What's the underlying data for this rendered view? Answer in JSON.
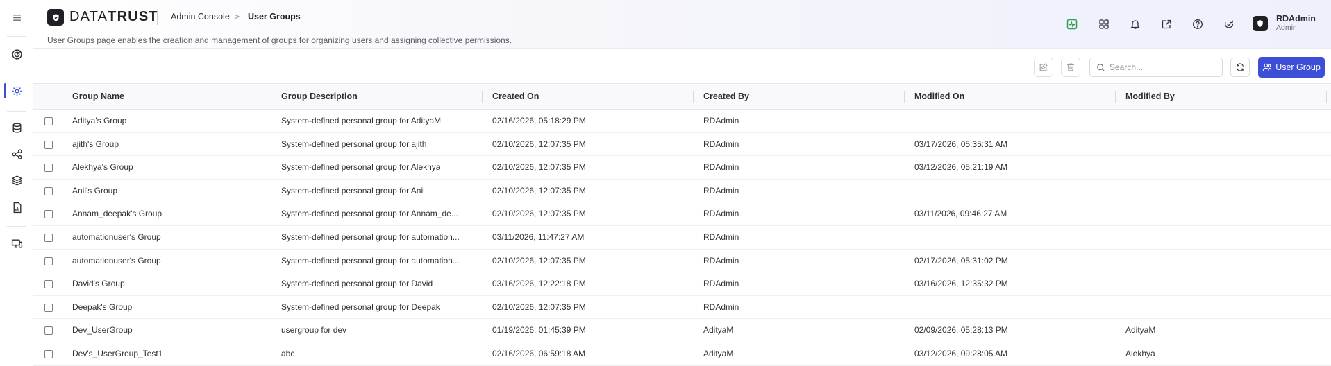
{
  "app": {
    "logo_text_light": "DATA",
    "logo_text_bold": "TRUST"
  },
  "breadcrumb": {
    "parent": "Admin Console",
    "separator": ">",
    "current": "User Groups"
  },
  "page": {
    "description": "User Groups page enables the creation and management of groups for organizing users and assigning collective permissions."
  },
  "user": {
    "name": "RDAdmin",
    "role": "Admin"
  },
  "header_icons": [
    "activity-icon",
    "apps-grid-icon",
    "bell-icon",
    "external-link-icon",
    "help-icon",
    "sync-check-icon"
  ],
  "sidebar_icons": [
    "menu-icon",
    "target-icon",
    "settings-icon",
    "database-icon",
    "share-nodes-icon",
    "layers-icon",
    "report-icon",
    "monitor-icon"
  ],
  "toolbar": {
    "search_placeholder": "Search...",
    "add_label": "User Group"
  },
  "colors": {
    "accent": "#3d4fd6",
    "activity_icon": "#2e9e5b"
  },
  "table": {
    "columns": [
      "Group Name",
      "Group Description",
      "Created On",
      "Created By",
      "Modified On",
      "Modified By"
    ],
    "rows": [
      [
        "Aditya's Group",
        "System-defined personal group for AdityaM",
        "02/16/2026, 05:18:29 PM",
        "RDAdmin",
        "",
        ""
      ],
      [
        "ajith's Group",
        "System-defined personal group for ajith",
        "02/10/2026, 12:07:35 PM",
        "RDAdmin",
        "03/17/2026, 05:35:31 AM",
        ""
      ],
      [
        "Alekhya's Group",
        "System-defined personal group for Alekhya",
        "02/10/2026, 12:07:35 PM",
        "RDAdmin",
        "03/12/2026, 05:21:19 AM",
        ""
      ],
      [
        "Anil's Group",
        "System-defined personal group for Anil",
        "02/10/2026, 12:07:35 PM",
        "RDAdmin",
        "",
        ""
      ],
      [
        "Annam_deepak's Group",
        "System-defined personal group for Annam_de...",
        "02/10/2026, 12:07:35 PM",
        "RDAdmin",
        "03/11/2026, 09:46:27 AM",
        ""
      ],
      [
        "automationuser's Group",
        "System-defined personal group for automation...",
        "03/11/2026, 11:47:27 AM",
        "RDAdmin",
        "",
        ""
      ],
      [
        "automationuser's Group",
        "System-defined personal group for automation...",
        "02/10/2026, 12:07:35 PM",
        "RDAdmin",
        "02/17/2026, 05:31:02 PM",
        ""
      ],
      [
        "David's Group",
        "System-defined personal group for David",
        "03/16/2026, 12:22:18 PM",
        "RDAdmin",
        "03/16/2026, 12:35:32 PM",
        ""
      ],
      [
        "Deepak's Group",
        "System-defined personal group for Deepak",
        "02/10/2026, 12:07:35 PM",
        "RDAdmin",
        "",
        ""
      ],
      [
        "Dev_UserGroup",
        "usergroup for dev",
        "01/19/2026, 01:45:39 PM",
        "AdityaM",
        "02/09/2026, 05:28:13 PM",
        "AdityaM"
      ],
      [
        "Dev's_UserGroup_Test1",
        "abc",
        "02/16/2026, 06:59:18 AM",
        "AdityaM",
        "03/12/2026, 09:28:05 AM",
        "Alekhya"
      ]
    ]
  }
}
